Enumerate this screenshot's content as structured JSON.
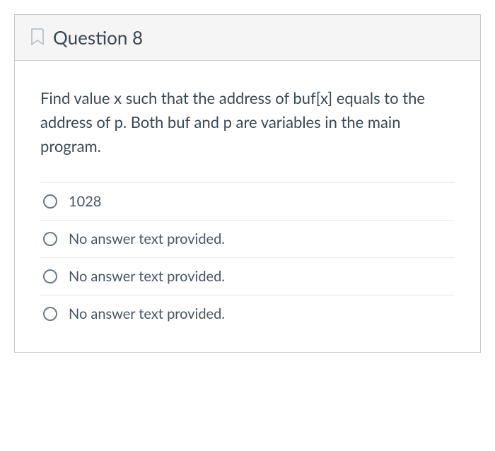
{
  "question": {
    "title": "Question 8",
    "text": "Find value x such that the address of buf[x] equals to the address of p. Both buf and p are variables in the main program.",
    "options": [
      "1028",
      "No answer text provided.",
      "No answer text provided.",
      "No answer text provided."
    ]
  }
}
